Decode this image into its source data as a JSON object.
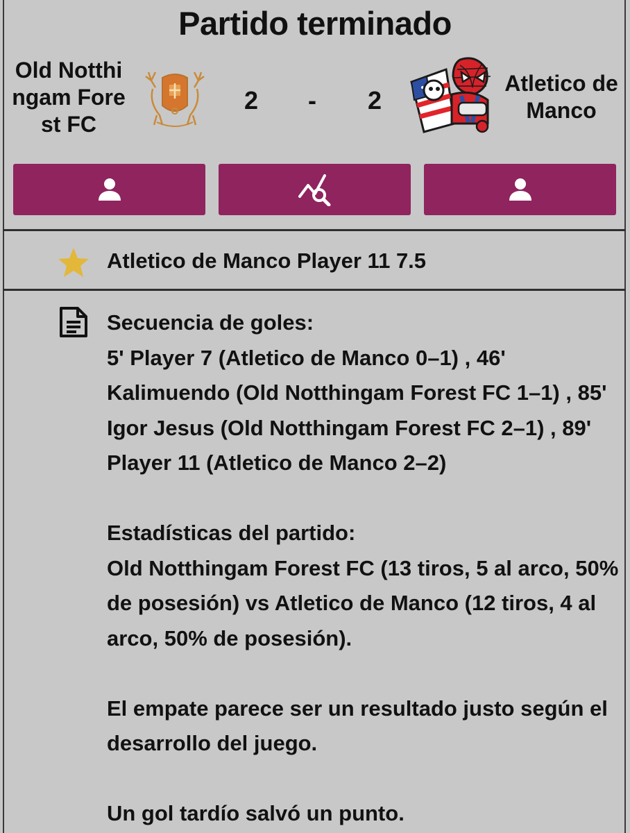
{
  "header": {
    "title": "Partido terminado"
  },
  "match": {
    "home_team": "Old Notthingam Forest FC",
    "away_team": "Atletico de Manco",
    "home_score": "2",
    "separator": "-",
    "away_score": "2"
  },
  "buttons": {
    "home_lineup_icon": "person-icon",
    "analysis_icon": "chart-search-icon",
    "away_lineup_icon": "person-icon",
    "color": "#8f245f"
  },
  "mvp": {
    "icon": "star-icon",
    "text": "Atletico de Manco Player 11 7.5",
    "star_color": "#e2b73a"
  },
  "summary": {
    "icon": "document-icon",
    "goals_heading": "Secuencia de goles:",
    "goals_text": "5' Player 7 (Atletico de Manco 0–1) , 46' Kalimuendo (Old Notthingam Forest FC 1–1) , 85' Igor Jesus (Old Notthingam Forest FC 2–1) , 89' Player 11 (Atletico de Manco 2–2)",
    "stats_heading": "Estadísticas del partido:",
    "stats_text": "Old Notthingam Forest FC (13 tiros, 5 al arco, 50% de posesión) vs Atletico de Manco (12 tiros, 4 al arco, 50% de posesión).",
    "comment_1": "El empate parece ser un resultado justo según el desarrollo del juego.",
    "comment_2": "Un gol tardío salvó un punto."
  }
}
